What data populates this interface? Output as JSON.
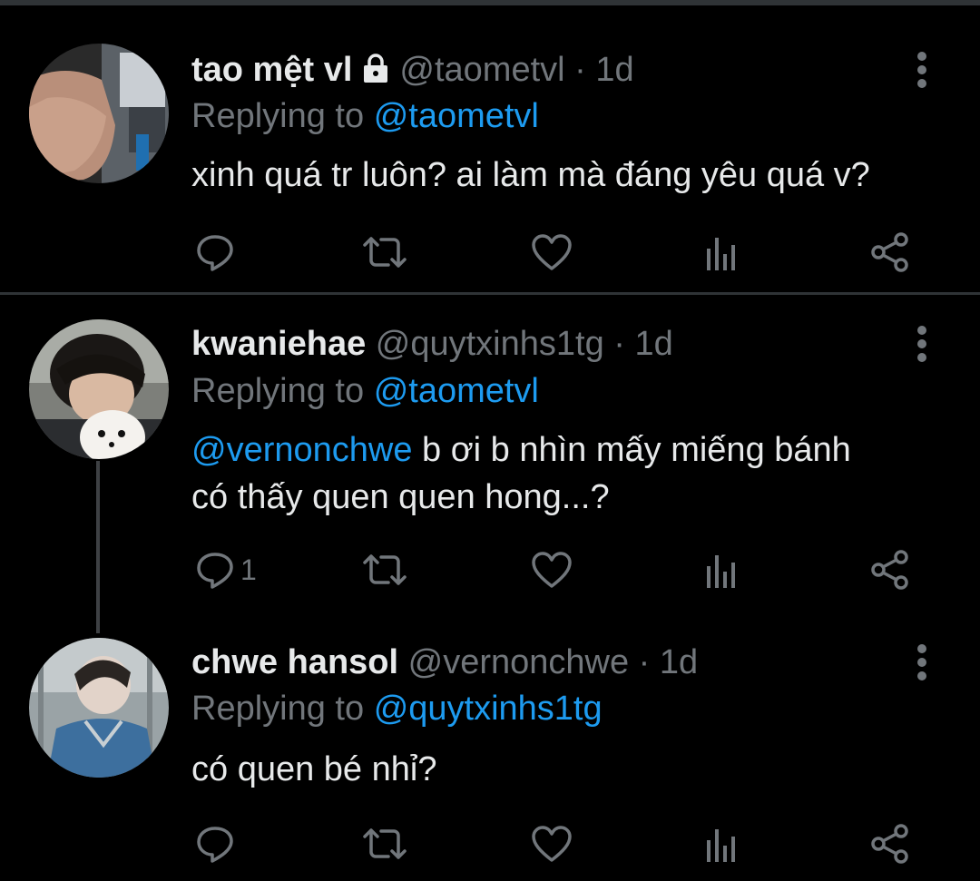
{
  "theme": {
    "background": "#000000",
    "text": "#e7e9ea",
    "muted": "#71767b",
    "accent": "#1d9bf0",
    "divider": "#2f3336"
  },
  "tweets": [
    {
      "display_name": "tao mệt vl",
      "locked": true,
      "handle": "@taometvl",
      "separator": "·",
      "time": "1d",
      "replying_prefix": "Replying to",
      "replying_to": "@taometvl",
      "text": "xinh quá tr luôn? ai làm mà đáng yêu quá v?",
      "reply_count": "",
      "icons": [
        "reply-icon",
        "retweet-icon",
        "like-icon",
        "analytics-icon",
        "share-icon"
      ]
    },
    {
      "display_name": "kwaniehae",
      "locked": false,
      "handle": "@quytxinhs1tg",
      "separator": "·",
      "time": "1d",
      "replying_prefix": "Replying to",
      "replying_to": "@taometvl",
      "mention": "@vernonchwe",
      "text_line1": " b ơi b nhìn mấy miếng bánh",
      "text_line2": "có thấy quen quen hong...?",
      "reply_count": "1",
      "icons": [
        "reply-icon",
        "retweet-icon",
        "like-icon",
        "analytics-icon",
        "share-icon"
      ]
    },
    {
      "display_name": "chwe hansol",
      "locked": false,
      "handle": "@vernonchwe",
      "separator": "·",
      "time": "1d",
      "replying_prefix": "Replying to",
      "replying_to": "@quytxinhs1tg",
      "text": "có quen bé nhỉ?",
      "reply_count": "",
      "icons": [
        "reply-icon",
        "retweet-icon",
        "like-icon",
        "analytics-icon",
        "share-icon"
      ]
    }
  ]
}
